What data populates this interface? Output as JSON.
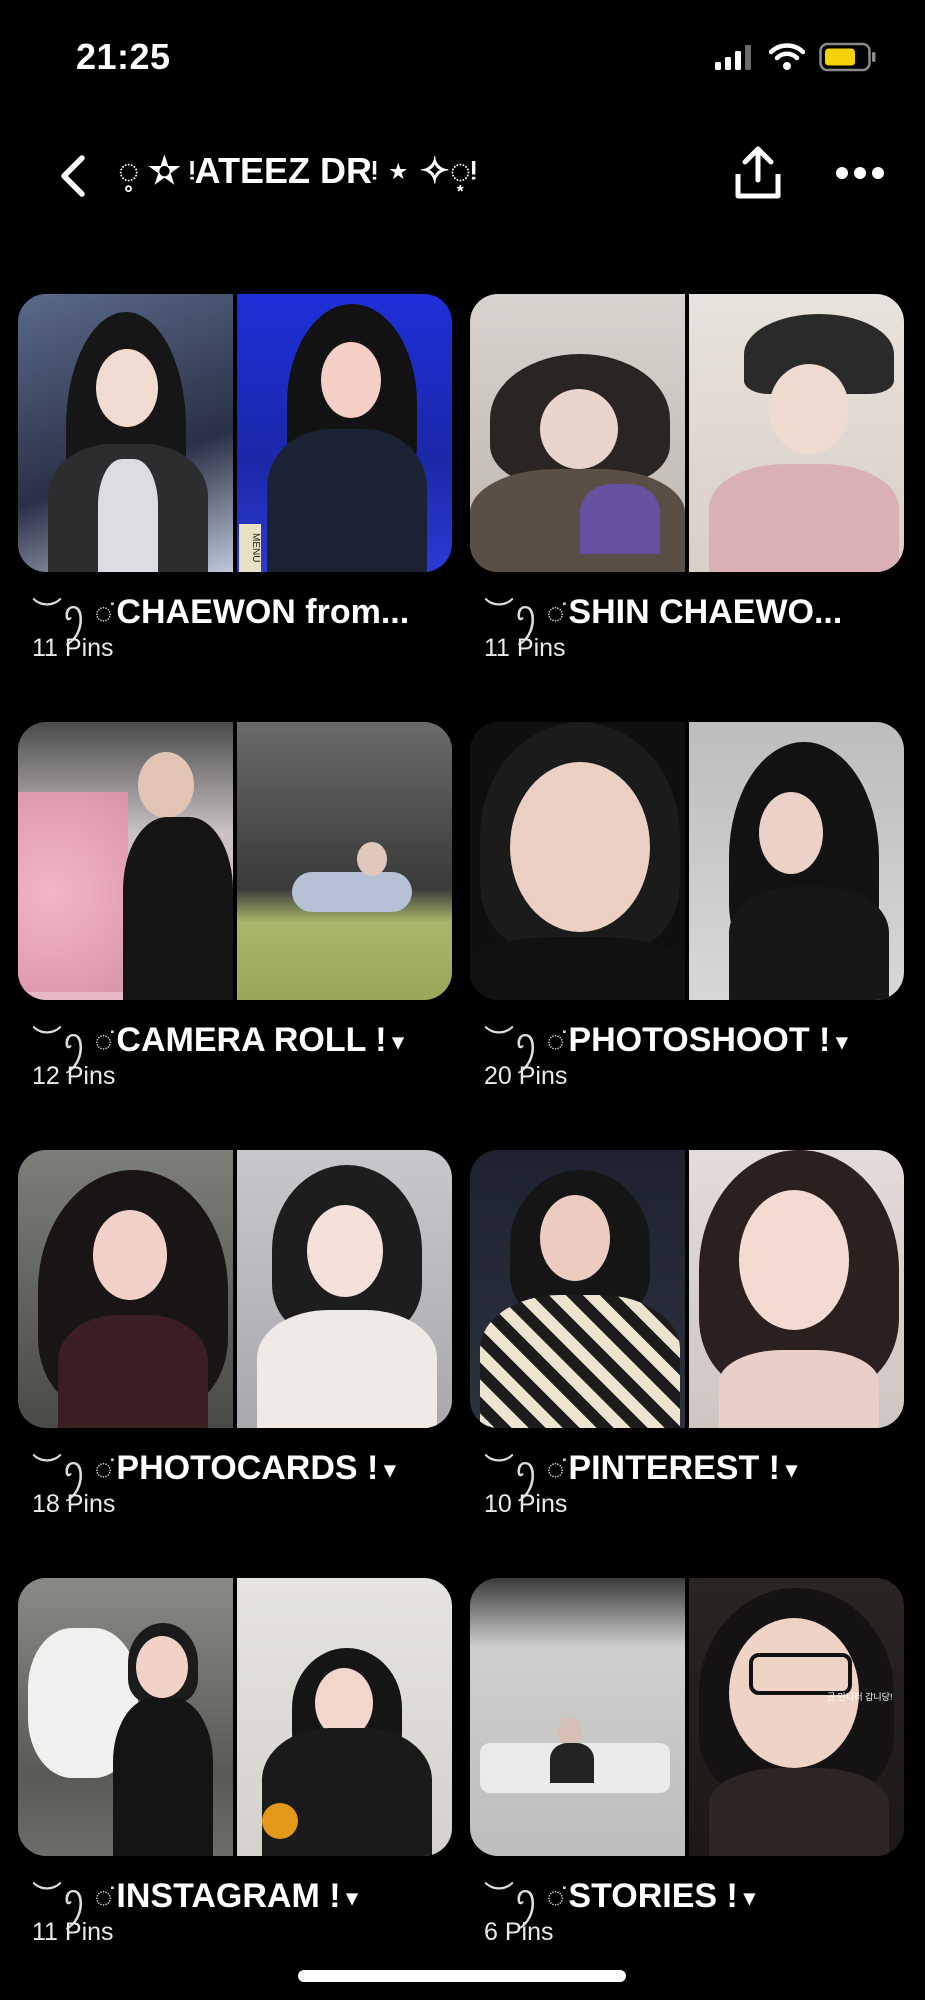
{
  "status": {
    "time": "21:25"
  },
  "header": {
    "title": "◌̥ ✫ ᵎATEEZ DRᵎ ⋆ ✧◌͙ᵎ"
  },
  "boards": [
    {
      "title": "CHAEWON from...",
      "deco": "︶ꪆ ◌̇",
      "caret": "",
      "count": "11 Pins",
      "colors": [
        [
          "#3a3f52",
          "#d9d9e0",
          "#101010"
        ],
        [
          "#1b2bd0",
          "#202050",
          "#111"
        ]
      ]
    },
    {
      "title": "SHIN CHAEWO...",
      "deco": "︶ꪆ ◌̇",
      "caret": "",
      "count": "11 Pins",
      "colors": [
        [
          "#cfc9c3",
          "#6e5f55",
          "#2a2220"
        ],
        [
          "#e9e3dc",
          "#cbb8aa",
          "#2b2b2b"
        ]
      ]
    },
    {
      "title": "CAMERA ROLL !",
      "deco": "︶ꪆ ◌̇",
      "caret": "▾",
      "count": "12 Pins",
      "colors": [
        [
          "#d9c6c9",
          "#e7a9b9",
          "#151515"
        ],
        [
          "#5b5b5b",
          "#a7b36a",
          "#202020"
        ]
      ]
    },
    {
      "title": "PHOTOSHOOT !",
      "deco": "︶ꪆ ◌̇",
      "caret": "▾",
      "count": "20 Pins",
      "colors": [
        [
          "#1a1a1a",
          "#e7c7b8",
          "#0c0c0c"
        ],
        [
          "#cfcfcf",
          "#e0c0b0",
          "#111"
        ]
      ]
    },
    {
      "title": "PHOTOCARDS !",
      "deco": "︶ꪆ ◌̇",
      "caret": "▾",
      "count": "18 Pins",
      "colors": [
        [
          "#6b6e68",
          "#eac2b6",
          "#1c1414"
        ],
        [
          "#bfbfc2",
          "#f1ded6",
          "#1c1c1c"
        ]
      ]
    },
    {
      "title": "PINTEREST !",
      "deco": "︶ꪆ ◌̇",
      "caret": "▾",
      "count": "10 Pins",
      "colors": [
        [
          "#222633",
          "#e8c6bb",
          "#151515"
        ],
        [
          "#d9cfcc",
          "#f0d4cb",
          "#2a1f1b"
        ]
      ]
    },
    {
      "title": "INSTAGRAM !",
      "deco": "︶ꪆ ◌̇",
      "caret": "▾",
      "count": "11 Pins",
      "colors": [
        [
          "#a9a9a4",
          "#f0f0ee",
          "#1a1a1a"
        ],
        [
          "#e4e2de",
          "#f3d6cb",
          "#151515"
        ]
      ]
    },
    {
      "title": "STORIES !",
      "deco": "︶ꪆ ◌̇",
      "caret": "▾",
      "count": "6 Pins",
      "colors": [
        [
          "#d5d5d3",
          "#b8b8b6",
          "#222"
        ],
        [
          "#2a2522",
          "#f0d2c6",
          "#121212"
        ]
      ]
    }
  ],
  "story_overlay_text": "곧 만나러 갑니당!",
  "menu_overlay_text": "MENU"
}
